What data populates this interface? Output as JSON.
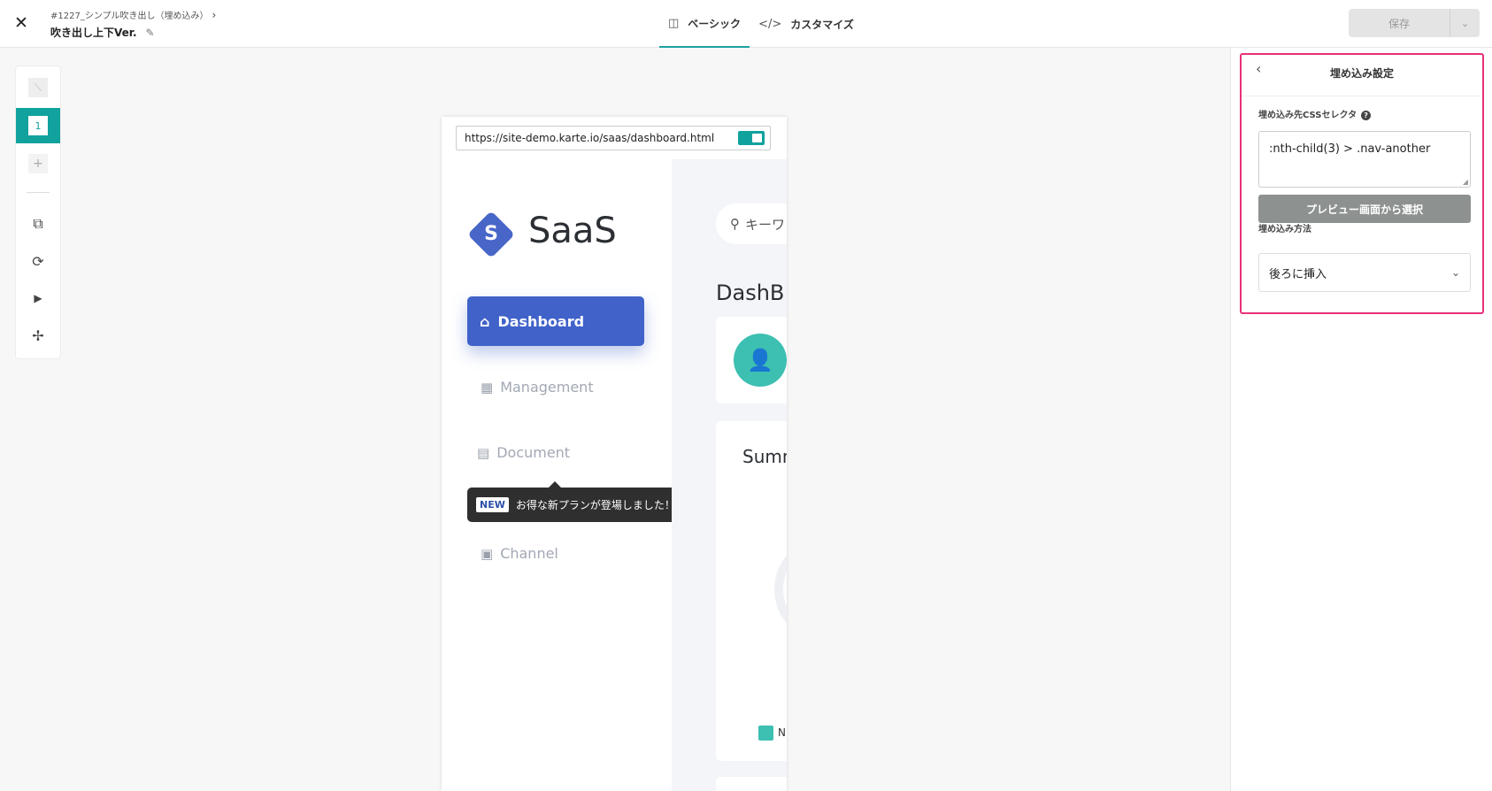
{
  "header": {
    "close_glyph": "✕",
    "breadcrumb": "#1227_シンプル吹き出し（埋め込み）",
    "breadcrumb_chevron": "›",
    "title": "吹き出し上下Ver.",
    "edit_glyph": "✎",
    "tabs": [
      {
        "icon": "◫",
        "label": "ベーシック",
        "active": true
      },
      {
        "icon": "</>",
        "label": "カスタマイズ",
        "active": false
      }
    ],
    "save_label": "保存",
    "save_dropdown_glyph": "⌄"
  },
  "toolbar": {
    "items": [
      {
        "name": "slash-placeholder",
        "glyph": "⟍"
      },
      {
        "name": "step-1",
        "glyph": "1"
      },
      {
        "name": "add-step",
        "glyph": "+"
      },
      {
        "name": "devices",
        "glyph": "⧉"
      },
      {
        "name": "rotate",
        "glyph": "⟳"
      },
      {
        "name": "play",
        "glyph": "▶"
      },
      {
        "name": "fullscreen",
        "glyph": "✢"
      }
    ]
  },
  "preview": {
    "url": "https://site-demo.karte.io/saas/dashboard.html",
    "logo_letter": "S",
    "logo_text": "SaaS",
    "nav": [
      {
        "icon": "⌂",
        "label": "Dashboard"
      },
      {
        "icon": "▦",
        "label": "Management"
      },
      {
        "icon": "▤",
        "label": "Document"
      },
      {
        "icon": "▣",
        "label": "Channel"
      }
    ],
    "tooltip": {
      "badge": "NEW",
      "text": "お得な新プランが登場しました！"
    },
    "search_icon": "⚲",
    "search_text": "キーワ",
    "dash_title": "DashB",
    "avatar_glyph": "👤",
    "summary_title": "Summ",
    "legend_text": "N"
  },
  "panel": {
    "back_glyph": "‹",
    "title": "埋め込み設定",
    "css_label": "埋め込み先CSSセレクタ",
    "help_glyph": "?",
    "css_value": ":nth-child(3) > .nav-another",
    "pick_button": "プレビュー画面から選択",
    "method_label": "埋め込み方法",
    "method_value": "後ろに挿入",
    "method_chevron": "⌄"
  },
  "colors": {
    "accent": "#11a29e",
    "highlight": "#e8307a",
    "nav_active": "#4062c9"
  }
}
